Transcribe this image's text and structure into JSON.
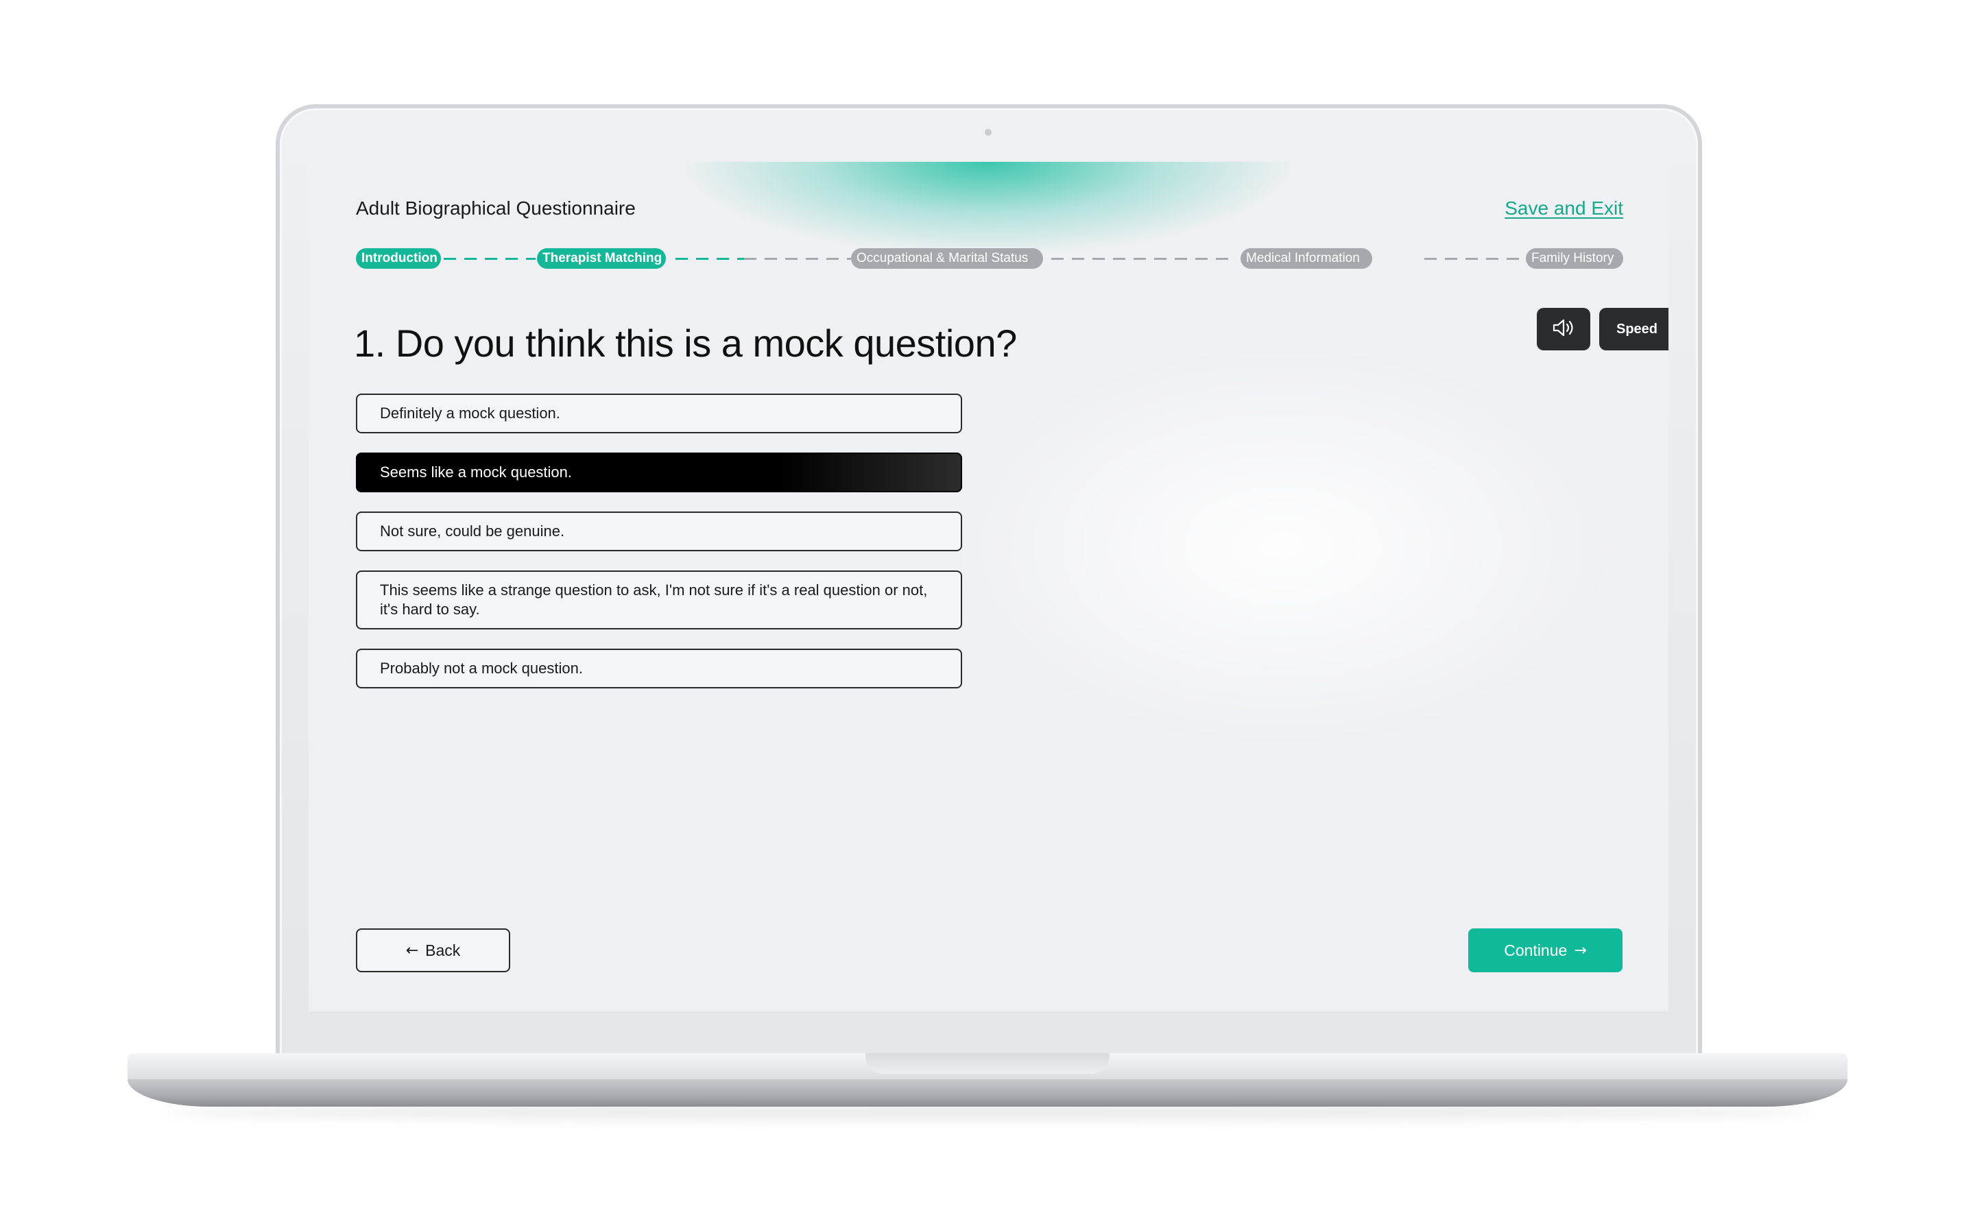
{
  "header": {
    "title": "Adult Biographical Questionnaire",
    "save_exit_label": "Save and Exit"
  },
  "progress": {
    "steps": [
      {
        "label": "Introduction",
        "status": "complete"
      },
      {
        "label": "Therapist Matching",
        "status": "current"
      },
      {
        "label": "Occupational & Marital Status",
        "status": "upcoming"
      },
      {
        "label": "Medical Information",
        "status": "upcoming"
      },
      {
        "label": "Family History",
        "status": "upcoming"
      }
    ]
  },
  "audio": {
    "speaker_icon": "speaker-icon",
    "speed_label": "Speed"
  },
  "question": {
    "text": "1. Do you think this is a mock question?",
    "options": [
      {
        "label": "Definitely a mock question.",
        "selected": false
      },
      {
        "label": "Seems like a mock question.",
        "selected": true
      },
      {
        "label": "Not sure, could be genuine.",
        "selected": false
      },
      {
        "label": "This seems like a strange question to ask, I'm not sure if it's a real question or not, it's hard to say.",
        "selected": false
      },
      {
        "label": "Probably not a mock question.",
        "selected": false
      }
    ]
  },
  "nav": {
    "back_label": "Back",
    "continue_label": "Continue",
    "back_icon": "arrow-left-icon",
    "continue_icon": "arrow-right-icon"
  },
  "colors": {
    "accent": "#0fb99a",
    "step_inactive": "#a6a8ad",
    "selected_option": "#000000"
  }
}
